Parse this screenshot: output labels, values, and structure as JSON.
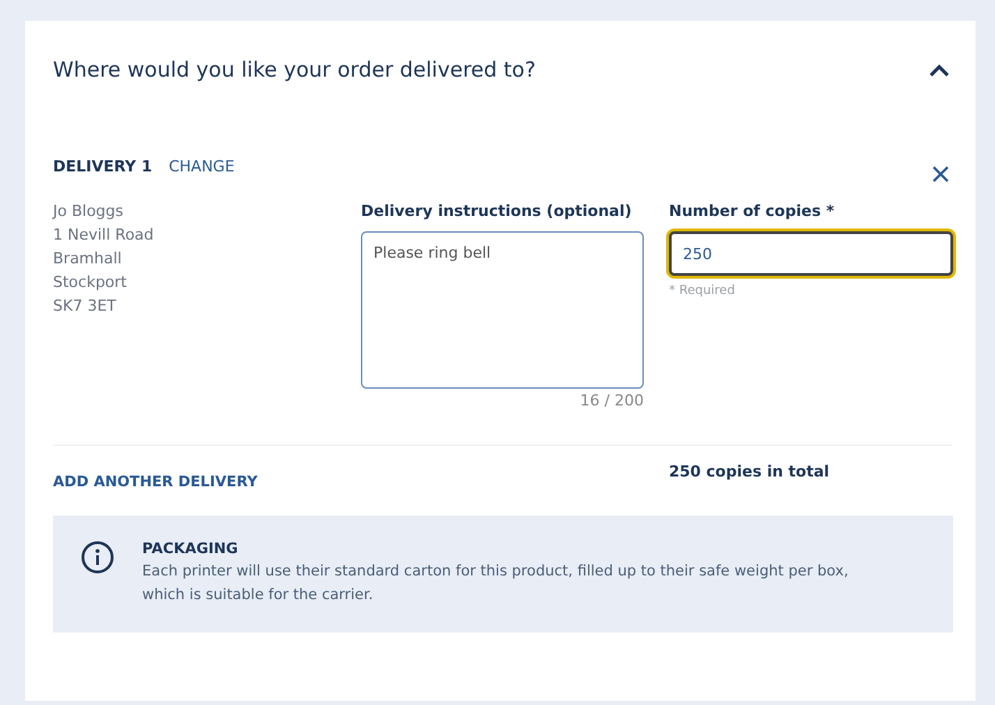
{
  "section": {
    "title": "Where would you like your order delivered to?",
    "expanded": true
  },
  "delivery": {
    "label": "DELIVERY 1",
    "change_link": "CHANGE",
    "address": [
      "Jo Bloggs",
      "1 Nevill Road",
      "Bramhall",
      "Stockport",
      "SK7 3ET"
    ],
    "instructions": {
      "label": "Delivery instructions (optional)",
      "value": "Please ring bell",
      "counter": "16 / 200"
    },
    "copies": {
      "label": "Number of copies *",
      "value": "250",
      "focused": true,
      "hint": "* Required"
    }
  },
  "add_delivery": "ADD ANOTHER DELIVERY",
  "total": "250 copies in total",
  "notice": {
    "title": "PACKAGING",
    "text": "Each printer will use their standard carton for this product, filled up to their safe weight per box, which is suitable for the carrier."
  }
}
